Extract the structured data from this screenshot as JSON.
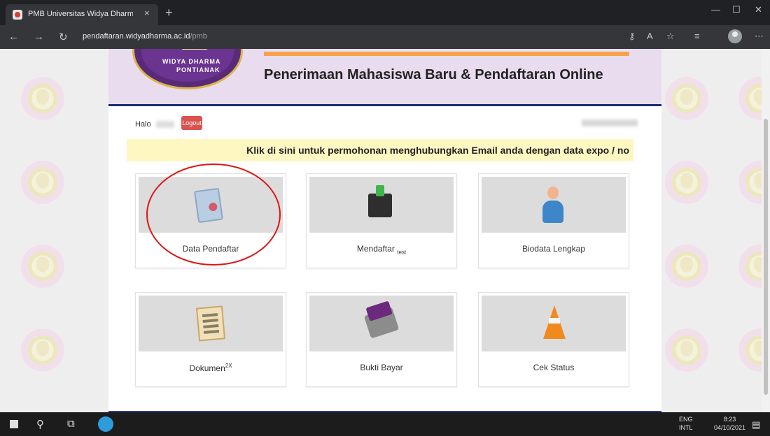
{
  "browser": {
    "tab_title": "PMB Universitas Widya Dharma |",
    "tab_close": "×",
    "new_tab": "+",
    "url_host": "pendaftaran.widyadharma.ac.id",
    "url_path": "/pmb",
    "icons": [
      "back-icon",
      "forward-icon",
      "refresh-icon",
      "key-icon",
      "read-aloud-icon",
      "favorites-add-icon",
      "favorites-icon",
      "profile-icon",
      "more-icon"
    ]
  },
  "header": {
    "seal_text_1": "WIDYA DHARMA",
    "seal_text_2": "PONTIANAK",
    "title": "Penerimaan Mahasiswa Baru & Pendaftaran Online"
  },
  "user": {
    "greeting": "Halo",
    "logout_label": "Logout"
  },
  "notice": {
    "text": "Klik di sini untuk permohonan menghubungkan Email anda dengan data expo / no"
  },
  "menu": [
    {
      "label": "Data Pendaftar",
      "icon": "document-pen-icon"
    },
    {
      "label": "Mendaftar",
      "sub": "test",
      "icon": "box-arrow-icon"
    },
    {
      "label": "Biodata Lengkap",
      "icon": "person-icon"
    },
    {
      "label": "Dokumen",
      "sup": "2X",
      "icon": "newspaper-icon"
    },
    {
      "label": "Bukti Bayar",
      "icon": "payment-card-icon"
    },
    {
      "label": "Cek Status",
      "icon": "traffic-cone-icon"
    }
  ],
  "taskbar": {
    "lang_1": "ENG",
    "lang_2": "INTL",
    "time": "8:23",
    "date": "04/10/2021"
  },
  "colors": {
    "logout": "#d9534f",
    "notice_bg": "#fff7c2",
    "header_bg": "#e9dcee",
    "accent_blue": "#1f2b78",
    "orange_bar": "#f5a34a",
    "highlight_ellipse": "#e01515"
  }
}
